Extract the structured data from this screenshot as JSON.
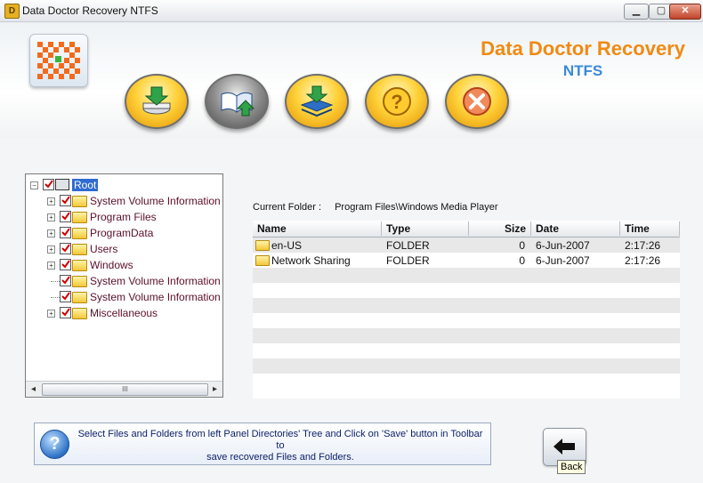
{
  "window": {
    "title": "Data Doctor Recovery NTFS",
    "icon": "app-icon",
    "controls": [
      "minimize",
      "maximize",
      "close"
    ]
  },
  "header": {
    "brand_line1": "Data Doctor Recovery",
    "brand_line2": "NTFS",
    "brand_color": "#f08a12",
    "brand_sub_color": "#3a8ad8",
    "logo_icon": "checkered-logo-icon"
  },
  "toolbar": {
    "buttons": [
      {
        "name": "save",
        "icon": "disk-download-icon"
      },
      {
        "name": "open",
        "icon": "book-upload-icon"
      },
      {
        "name": "load",
        "icon": "stack-download-icon"
      },
      {
        "name": "help",
        "icon": "question-icon"
      },
      {
        "name": "exit",
        "icon": "close-x-icon"
      }
    ]
  },
  "tree": {
    "items": [
      {
        "label": "Root",
        "level": 0,
        "expanded": true
      },
      {
        "label": "System Volume Information",
        "level": 1,
        "expandable": true
      },
      {
        "label": "Program Files",
        "level": 1,
        "expandable": true
      },
      {
        "label": "ProgramData",
        "level": 1,
        "expandable": true
      },
      {
        "label": "Users",
        "level": 1,
        "expandable": true
      },
      {
        "label": "Windows",
        "level": 1,
        "expandable": true
      },
      {
        "label": "System Volume Information",
        "level": 1,
        "expandable": false
      },
      {
        "label": "System Volume Information",
        "level": 1,
        "expandable": false
      },
      {
        "label": "Miscellaneous",
        "level": 1,
        "expandable": true
      }
    ],
    "scroll_thumb": "III"
  },
  "current_folder": {
    "label": "Current Folder  :",
    "value": "Program Files\\Windows Media Player"
  },
  "file_list": {
    "columns": [
      "Name",
      "Type",
      "Size",
      "Date",
      "Time"
    ],
    "rows": [
      {
        "name": "en-US",
        "type": "FOLDER",
        "size": "0",
        "date": "6-Jun-2007",
        "time": "2:17:26"
      },
      {
        "name": "Network Sharing",
        "type": "FOLDER",
        "size": "0",
        "date": "6-Jun-2007",
        "time": "2:17:26"
      }
    ]
  },
  "info": {
    "text_line1": "Select Files and Folders from left Panel Directories' Tree and Click on 'Save' button in Toolbar to",
    "text_line2": "save recovered Files and Folders."
  },
  "back_button": {
    "tooltip": "Back",
    "icon": "arrow-left-icon"
  }
}
